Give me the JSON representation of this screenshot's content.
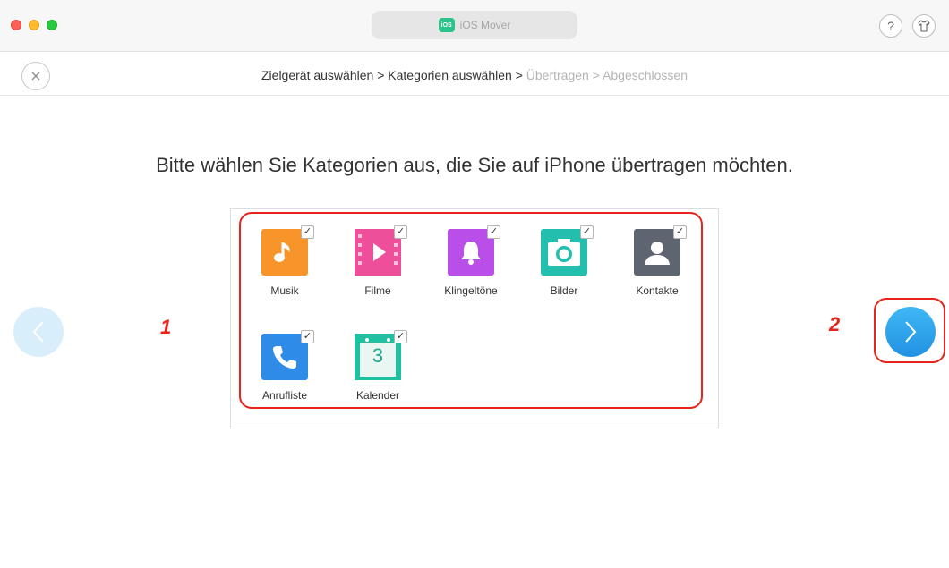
{
  "window": {
    "app_logo_text": "iOS",
    "app_title": "iOS Mover",
    "help_label": "?"
  },
  "breadcrumb": {
    "steps": [
      {
        "label": "Zielgerät auswählen",
        "active": true
      },
      {
        "label": "Kategorien auswählen",
        "active": true
      },
      {
        "label": "Übertragen",
        "active": false
      },
      {
        "label": "Abgeschlossen",
        "active": false
      }
    ],
    "separator": ">"
  },
  "heading": "Bitte wählen Sie Kategorien aus, die Sie auf iPhone übertragen möchten.",
  "categories": [
    {
      "label": "Musik",
      "icon": "music-note-icon",
      "checked": true,
      "color": "#f7952a"
    },
    {
      "label": "Filme",
      "icon": "film-icon",
      "checked": true,
      "color": "#f0518a"
    },
    {
      "label": "Klingeltöne",
      "icon": "bell-icon",
      "checked": true,
      "color": "#b94fe8"
    },
    {
      "label": "Bilder",
      "icon": "camera-icon",
      "checked": true,
      "color": "#22bfae"
    },
    {
      "label": "Kontakte",
      "icon": "person-icon",
      "checked": true,
      "color": "#5f6570"
    },
    {
      "label": "Anrufliste",
      "icon": "phone-icon",
      "checked": true,
      "color": "#2e8be8"
    },
    {
      "label": "Kalender",
      "icon": "calendar-icon",
      "checked": true,
      "color": "#1fbfa0",
      "day": "3"
    }
  ],
  "annotations": {
    "marker_1": "1",
    "marker_2": "2",
    "highlight_color": "#e8231b"
  }
}
